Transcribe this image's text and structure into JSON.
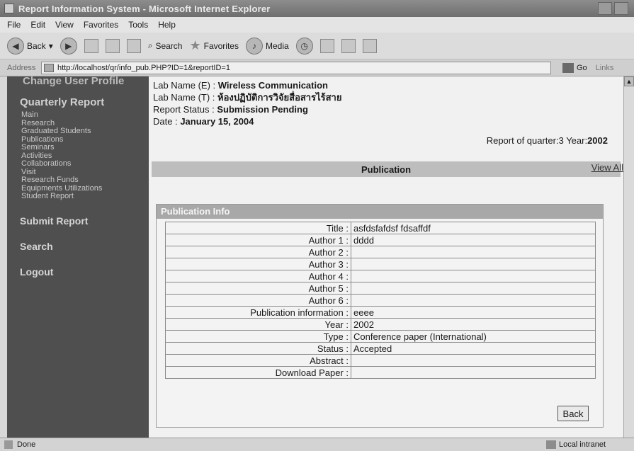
{
  "window": {
    "title": "Report Information System - Microsoft Internet Explorer"
  },
  "menu": [
    "File",
    "Edit",
    "View",
    "Favorites",
    "Tools",
    "Help"
  ],
  "toolbar": {
    "back": "Back",
    "search": "Search",
    "favorites": "Favorites",
    "media": "Media"
  },
  "address": {
    "label": "Address",
    "url": "http://localhost/qr/info_pub.PHP?ID=1&reportID=1",
    "go": "Go",
    "links": "Links"
  },
  "sidebar": {
    "top_cut": "Change User Profile",
    "quarterly": "Quarterly Report",
    "items": [
      "Main",
      "Research",
      "Graduated Students",
      "Publications",
      "Seminars",
      "Activities",
      "Collaborations",
      "Visit",
      "Research Funds",
      "Equipments Utilizations",
      "Student Report"
    ],
    "submit": "Submit Report",
    "search": "Search",
    "logout": "Logout"
  },
  "header": {
    "lab_e_label": "Lab Name (E) :",
    "lab_e": "Wireless Communication",
    "lab_t_label": "Lab Name (T) :",
    "lab_t": "ห้องปฏิบัติการวิจัยสื่อสารไร้สาย",
    "status_label": "Report Status :",
    "status": "Submission Pending",
    "date_label": "Date :",
    "date": "January 15, 2004",
    "quarter_text": "Report of quarter:3 Year:",
    "year": "2002"
  },
  "section": {
    "title": "Publication",
    "view_all": "View All"
  },
  "pub_info": {
    "header": "Publication Info",
    "rows": [
      {
        "label": "Title :",
        "value": "asfdsfafdsf fdsaffdf"
      },
      {
        "label": "Author 1 :",
        "value": "dddd"
      },
      {
        "label": "Author 2 :",
        "value": ""
      },
      {
        "label": "Author 3 :",
        "value": ""
      },
      {
        "label": "Author 4 :",
        "value": ""
      },
      {
        "label": "Author 5 :",
        "value": ""
      },
      {
        "label": "Author 6 :",
        "value": ""
      },
      {
        "label": "Publication information :",
        "value": "eeee"
      },
      {
        "label": "Year :",
        "value": "2002"
      },
      {
        "label": "Type :",
        "value": "Conference paper (International)"
      },
      {
        "label": "Status :",
        "value": "Accepted"
      },
      {
        "label": "Abstract :",
        "value": ""
      },
      {
        "label": "Download Paper :",
        "value": ""
      }
    ],
    "back": "Back"
  },
  "status": {
    "left": "Done",
    "zone": "Local intranet"
  }
}
